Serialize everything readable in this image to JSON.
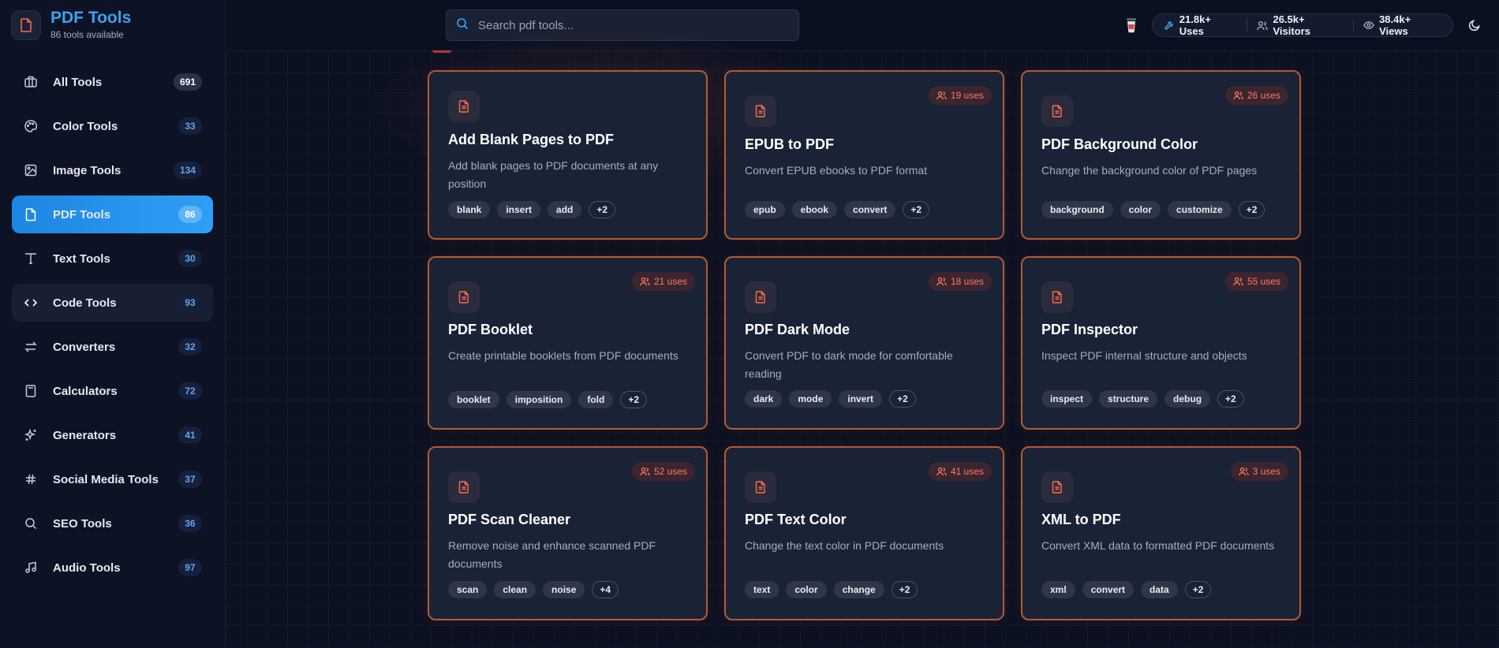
{
  "brand": {
    "title": "PDF Tools",
    "subtitle": "86 tools available"
  },
  "search": {
    "placeholder": "Search pdf tools..."
  },
  "stats": {
    "uses": "21.8k+ Uses",
    "visitors": "26.5k+ Visitors",
    "views": "38.4k+ Views"
  },
  "sidebar": {
    "items": [
      {
        "label": "All Tools",
        "count": "691",
        "icon": "briefcase-icon"
      },
      {
        "label": "Color Tools",
        "count": "33",
        "icon": "palette-icon"
      },
      {
        "label": "Image Tools",
        "count": "134",
        "icon": "image-icon"
      },
      {
        "label": "PDF Tools",
        "count": "86",
        "icon": "file-icon"
      },
      {
        "label": "Text Tools",
        "count": "30",
        "icon": "type-icon"
      },
      {
        "label": "Code Tools",
        "count": "93",
        "icon": "code-icon"
      },
      {
        "label": "Converters",
        "count": "32",
        "icon": "arrows-icon"
      },
      {
        "label": "Calculators",
        "count": "72",
        "icon": "calculator-icon"
      },
      {
        "label": "Generators",
        "count": "41",
        "icon": "sparkle-icon"
      },
      {
        "label": "Social Media Tools",
        "count": "37",
        "icon": "hash-icon"
      },
      {
        "label": "SEO Tools",
        "count": "36",
        "icon": "search-icon"
      },
      {
        "label": "Audio Tools",
        "count": "97",
        "icon": "music-icon"
      }
    ]
  },
  "cards": [
    {
      "title": "Add Blank Pages to PDF",
      "desc": "Add blank pages to PDF documents at any position",
      "uses": "",
      "tags": [
        "blank",
        "insert",
        "add"
      ],
      "more": "+2"
    },
    {
      "title": "EPUB to PDF",
      "desc": "Convert EPUB ebooks to PDF format",
      "uses": "19 uses",
      "tags": [
        "epub",
        "ebook",
        "convert"
      ],
      "more": "+2"
    },
    {
      "title": "PDF Background Color",
      "desc": "Change the background color of PDF pages",
      "uses": "26 uses",
      "tags": [
        "background",
        "color",
        "customize"
      ],
      "more": "+2"
    },
    {
      "title": "PDF Booklet",
      "desc": "Create printable booklets from PDF documents",
      "uses": "21 uses",
      "tags": [
        "booklet",
        "imposition",
        "fold"
      ],
      "more": "+2"
    },
    {
      "title": "PDF Dark Mode",
      "desc": "Convert PDF to dark mode for comfortable reading",
      "uses": "18 uses",
      "tags": [
        "dark",
        "mode",
        "invert"
      ],
      "more": "+2"
    },
    {
      "title": "PDF Inspector",
      "desc": "Inspect PDF internal structure and objects",
      "uses": "55 uses",
      "tags": [
        "inspect",
        "structure",
        "debug"
      ],
      "more": "+2"
    },
    {
      "title": "PDF Scan Cleaner",
      "desc": "Remove noise and enhance scanned PDF documents",
      "uses": "52 uses",
      "tags": [
        "scan",
        "clean",
        "noise"
      ],
      "more": "+4"
    },
    {
      "title": "PDF Text Color",
      "desc": "Change the text color in PDF documents",
      "uses": "41 uses",
      "tags": [
        "text",
        "color",
        "change"
      ],
      "more": "+2"
    },
    {
      "title": "XML to PDF",
      "desc": "Convert XML data to formatted PDF documents",
      "uses": "3 uses",
      "tags": [
        "xml",
        "convert",
        "data"
      ],
      "more": "+2"
    }
  ],
  "colors": {
    "accent": "#2f9ef6",
    "card_border": "#b45a32",
    "uses_text": "#ff7a5c"
  }
}
